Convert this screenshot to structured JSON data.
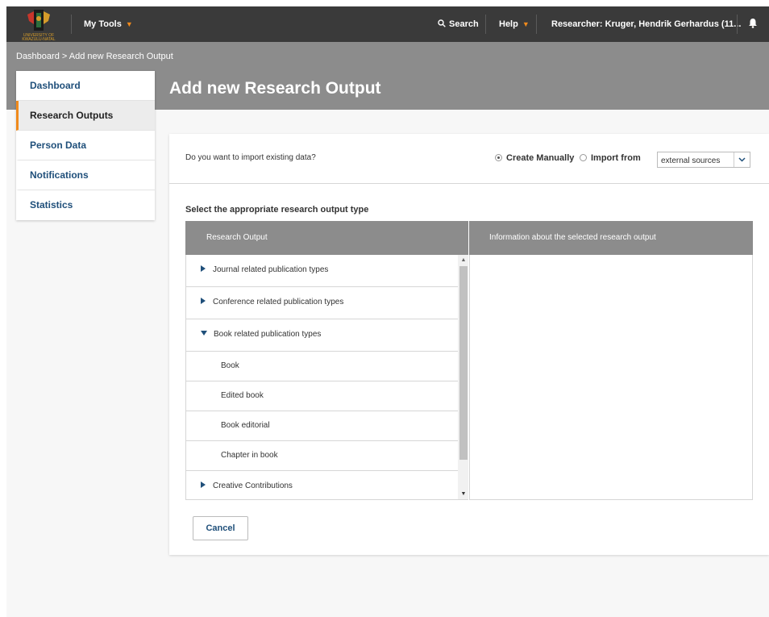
{
  "topbar": {
    "logo_text": "UNIVERSITY OF KWAZULU-NATAL",
    "my_tools": "My Tools",
    "search": "Search",
    "help": "Help",
    "researcher": "Researcher: Kruger, Hendrik Gerhardus (11...",
    "caret": "▼",
    "icons": [
      "search-icon",
      "bell-icon",
      "university-logo"
    ]
  },
  "breadcrumb": "Dashboard > Add new Research Output",
  "page_title": "Add new Research Output",
  "sidebar": {
    "items": [
      {
        "label": "Dashboard"
      },
      {
        "label": "Research Outputs",
        "active": true
      },
      {
        "label": "Person Data"
      },
      {
        "label": "Notifications"
      },
      {
        "label": "Statistics"
      }
    ]
  },
  "import": {
    "question": "Do you want to import existing data?",
    "create_manually": "Create Manually",
    "import_from": "Import from",
    "selected_mode": "Create Manually",
    "source_value": "external sources",
    "select_arrow": "⌄"
  },
  "type_label": "Select the appropriate research output type",
  "table": {
    "col_left": "Research Output",
    "col_right": "Information about the selected research output",
    "items": [
      {
        "label": "Journal related publication types",
        "kind": "collapsed"
      },
      {
        "label": "Conference related publication types",
        "kind": "collapsed"
      },
      {
        "label": "Book related publication types",
        "kind": "expanded"
      },
      {
        "label": "Book",
        "kind": "child"
      },
      {
        "label": "Edited book",
        "kind": "child"
      },
      {
        "label": "Book editorial",
        "kind": "child"
      },
      {
        "label": "Chapter in book",
        "kind": "child"
      },
      {
        "label": "Creative Contributions",
        "kind": "collapsed"
      }
    ]
  },
  "cancel_label": "Cancel",
  "colors": {
    "topbar": "#3a3a3a",
    "header_band": "#8c8c8c",
    "accent_orange": "#f08a1c",
    "link_blue": "#1f4f7a"
  }
}
